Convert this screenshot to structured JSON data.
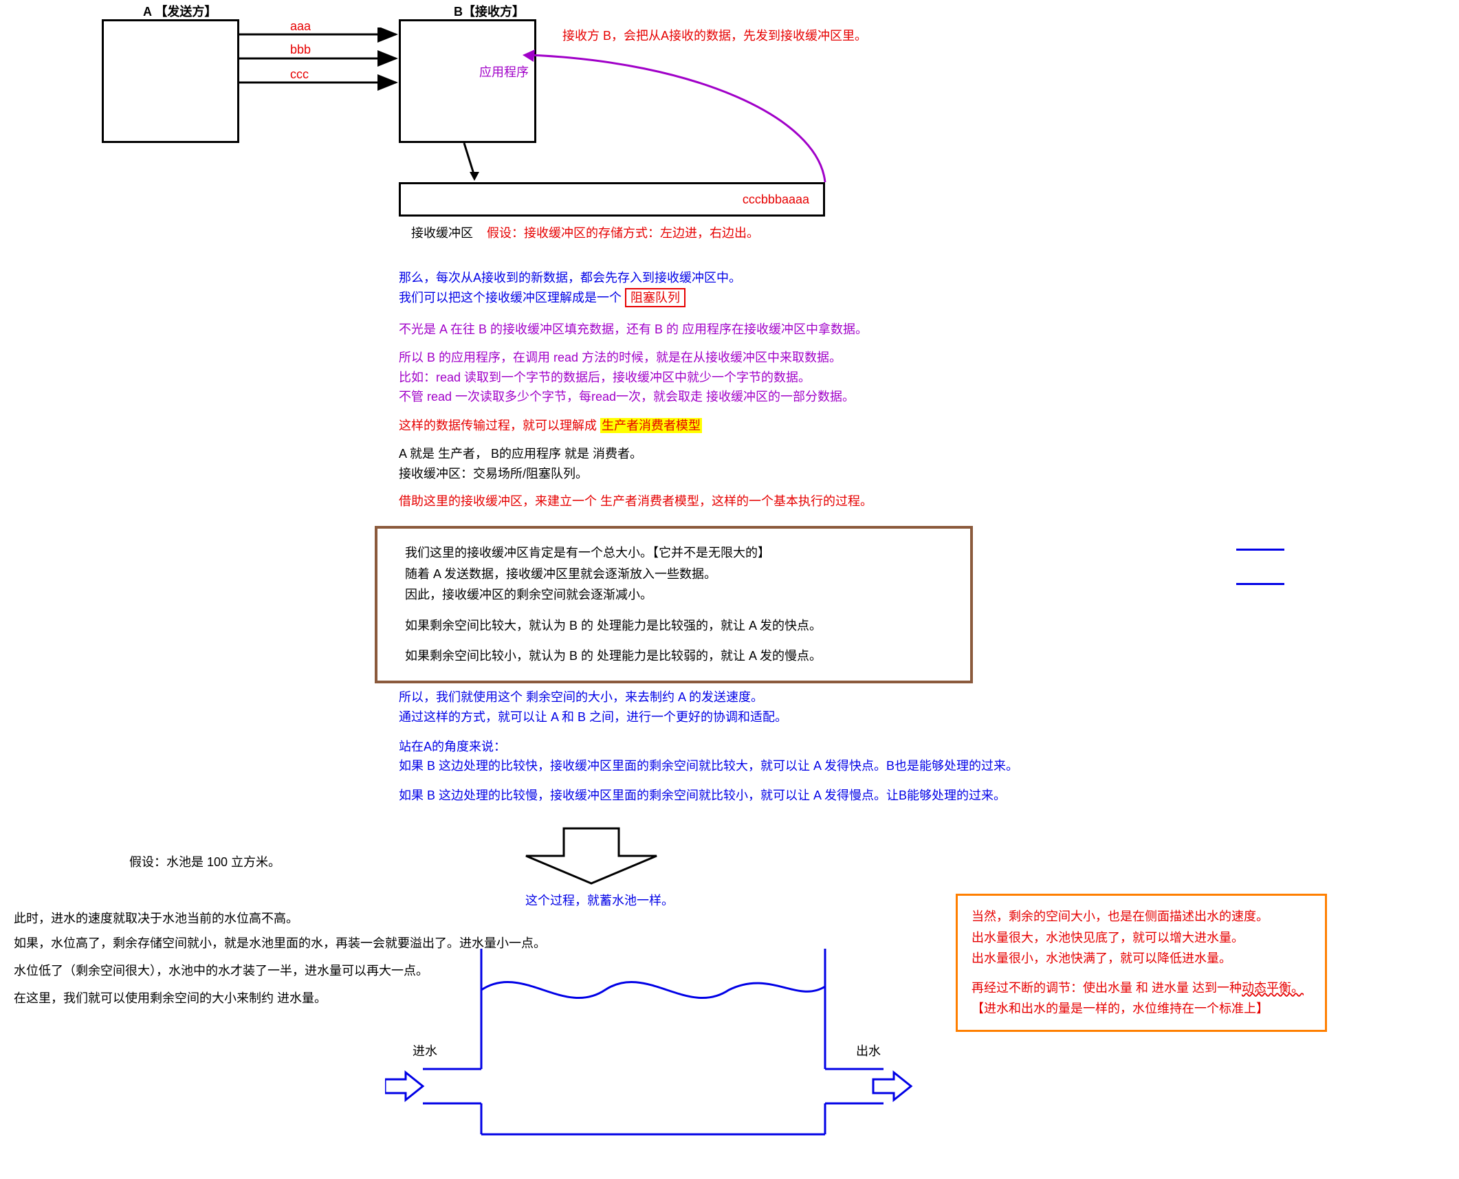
{
  "top": {
    "senderLabel": "A 【发送方】",
    "receiverLabel": "B【接收方】",
    "appLabel": "应用程序",
    "msg1": "aaa",
    "msg2": "bbb",
    "msg3": "ccc",
    "recvNote": "接收方 B，会把从A接收的数据，先发到接收缓冲区里。",
    "bufferContent": "cccbbbaaaa",
    "bufferLabel": "接收缓冲区",
    "bufferAssumption": "假设：接收缓冲区的存储方式：左边进，右边出。"
  },
  "textA": {
    "l1": "那么，每次从A接收到的新数据，都会先存入到接收缓冲区中。",
    "l2a": "我们可以把这个接收缓冲区理解成是一个",
    "l2b": "阻塞队列"
  },
  "textB": {
    "l1": "不光是 A 在往 B 的接收缓冲区填充数据，还有 B 的 应用程序在接收缓冲区中拿数据。",
    "l2": "所以 B 的应用程序，在调用 read 方法的时候，就是在从接收缓冲区中来取数据。",
    "l3": "比如：read 读取到一个字节的数据后，接收缓冲区中就少一个字节的数据。",
    "l4": "不管 read 一次读取多少个字节，每read一次，就会取走 接收缓冲区的一部分数据。"
  },
  "textC": {
    "l1a": "这样的数据传输过程，就可以理解成",
    "l1b": "生产者消费者模型",
    "l2": "A 就是 生产者， B的应用程序 就是 消费者。",
    "l3": "接收缓冲区：交易场所/阻塞队列。",
    "l4": "借助这里的接收缓冲区，来建立一个 生产者消费者模型，这样的一个基本执行的过程。"
  },
  "brownBox": {
    "l1": "我们这里的接收缓冲区肯定是有一个总大小。【它并不是无限大的】",
    "l2": "随着 A 发送数据，接收缓冲区里就会逐渐放入一些数据。",
    "l3": "因此，接收缓冲区的剩余空间就会逐渐减小。",
    "l4": "如果剩余空间比较大，就认为 B 的 处理能力是比较强的，就让 A 发的快点。",
    "l5": "如果剩余空间比较小，就认为 B 的 处理能力是比较弱的，就让 A 发的慢点。"
  },
  "textD": {
    "l1": "所以，我们就使用这个 剩余空间的大小，来去制约 A 的发送速度。",
    "l2": "通过这样的方式，就可以让 A 和 B 之间，进行一个更好的协调和适配。",
    "l3": "站在A的角度来说：",
    "l4": "如果 B 这边处理的比较快，接收缓冲区里面的剩余空间就比较大，就可以让 A 发得快点。B也是能够处理的过来。",
    "l5": "如果 B 这边处理的比较慢，接收缓冲区里面的剩余空间就比较小，就可以让 A 发得慢点。让B能够处理的过来。"
  },
  "analogy": {
    "heading": "这个过程，就蓄水池一样。",
    "leftAssume": "假设：水池是 100 立方米。",
    "left1": "此时，进水的速度就取决于水池当前的水位高不高。",
    "left2": "如果，水位高了，剩余存储空间就小，就是水池里面的水，再装一会就要溢出了。进水量小一点。",
    "left3": "水位低了（剩余空间很大），水池中的水才装了一半，进水量可以再大一点。",
    "left4": "在这里，我们就可以使用剩余空间的大小来制约 进水量。",
    "inLabel": "进水",
    "outLabel": "出水"
  },
  "orangeBox": {
    "l1": "当然，剩余的空间大小，也是在侧面描述出水的速度。",
    "l2": "出水量很大，水池快见底了，就可以增大进水量。",
    "l3": "出水量很小，水池快满了，就可以降低进水量。",
    "l4a": "再经过不断的调节：使出水量 和 进水量 达到一种",
    "l4b": "动态平衡。",
    "l5": "【进水和出水的量是一样的，水位维持在一个标准上】"
  }
}
